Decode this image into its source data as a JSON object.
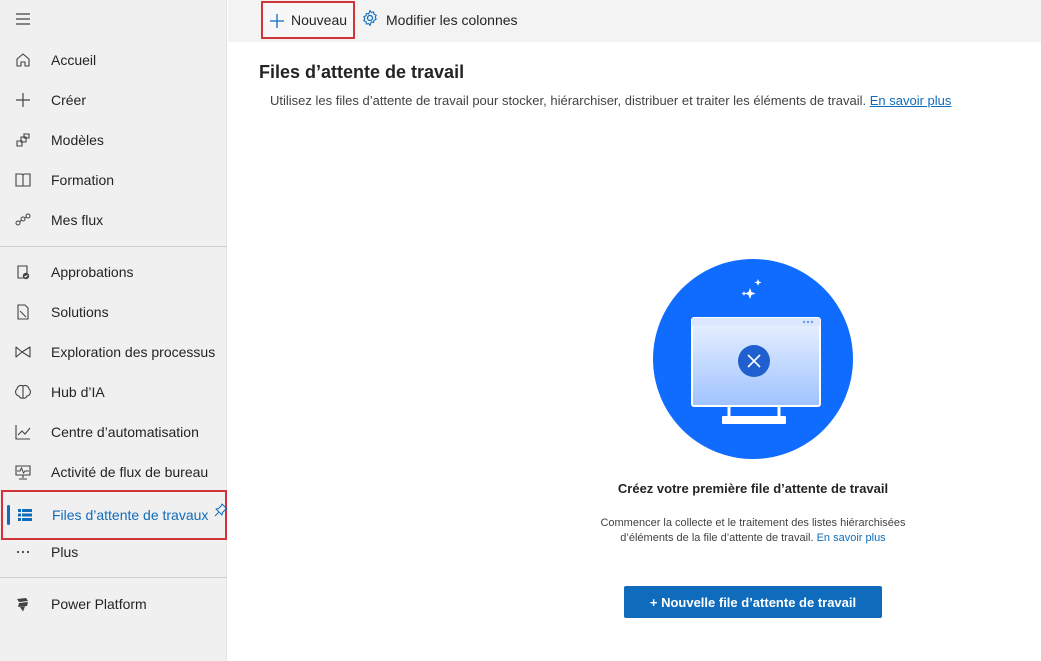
{
  "sidebar": {
    "items": [
      {
        "label": "Accueil",
        "icon": "home-icon"
      },
      {
        "label": "Créer",
        "icon": "plus-icon"
      },
      {
        "label": "Modèles",
        "icon": "templates-icon"
      },
      {
        "label": "Formation",
        "icon": "book-icon"
      },
      {
        "label": "Mes flux",
        "icon": "flow-icon"
      },
      {
        "label": "Approbations",
        "icon": "approvals-icon"
      },
      {
        "label": "Solutions",
        "icon": "solutions-icon"
      },
      {
        "label": "Exploration des processus",
        "icon": "process-mining-icon"
      },
      {
        "label": "Hub d’IA",
        "icon": "ai-hub-icon"
      },
      {
        "label": "Centre d’automatisation",
        "icon": "chart-icon"
      },
      {
        "label": "Activité de flux de bureau",
        "icon": "monitor-activity-icon"
      },
      {
        "label": "Files d’attente de travaux",
        "icon": "work-queue-icon",
        "active": true
      },
      {
        "label": "Plus",
        "icon": "more-icon"
      },
      {
        "label": "Power Platform",
        "icon": "power-platform-icon"
      }
    ]
  },
  "toolbar": {
    "new_label": "Nouveau",
    "edit_columns_label": "Modifier les colonnes"
  },
  "main": {
    "title": "Files d’attente de travail",
    "description": "Utilisez les files d’attente de travail pour stocker, hiérarchiser, distribuer et traiter les éléments de travail.",
    "learn_more": "En savoir plus",
    "empty_title": "Créez votre première file d’attente de travail",
    "empty_desc": "Commencer la collecte et le traitement des listes hiérarchisées d’éléments de la file d’attente de travail.",
    "empty_learn_more": "En savoir plus",
    "primary_button": "+ Nouvelle file d’attente de travail"
  },
  "colors": {
    "accent": "#0f6cbd",
    "highlight_border": "#d13438",
    "illustration_blue": "#0f6cff"
  }
}
